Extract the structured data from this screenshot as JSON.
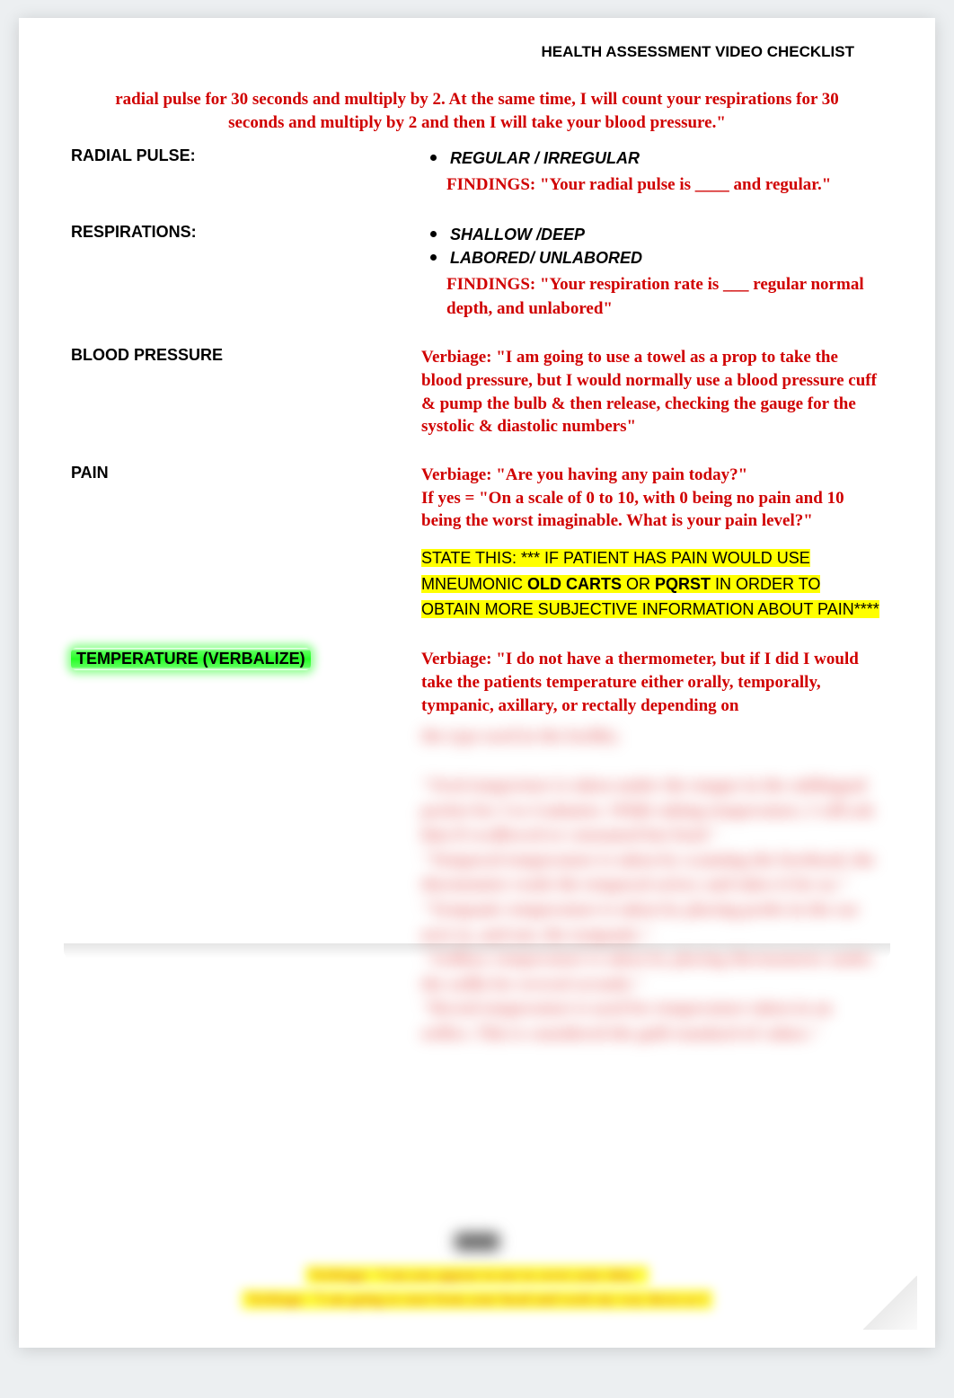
{
  "header": {
    "title": "HEALTH ASSESSMENT VIDEO CHECKLIST"
  },
  "intro": "radial pulse for 30 seconds and multiply by 2. At the same time, I will count your respirations for 30 seconds and multiply by 2 and then I will take your blood pressure.\"",
  "rows": {
    "radial": {
      "label": "RADIAL PULSE:",
      "bullets": [
        "REGULAR / IRREGULAR"
      ],
      "findings": "FINDINGS: \"Your radial pulse is ____ and regular.\""
    },
    "resp": {
      "label": "RESPIRATIONS:",
      "bullets": [
        "SHALLOW /DEEP",
        "LABORED/ UNLABORED"
      ],
      "findings": "FINDINGS: \"Your respiration rate is ___ regular normal depth, and unlabored\""
    },
    "bp": {
      "label": "BLOOD PRESSURE",
      "verbiage": "Verbiage: \"I am going to use a towel as a prop to take the blood pressure, but I would normally use a blood pressure cuff & pump the bulb & then release, checking the gauge for the systolic & diastolic numbers\""
    },
    "pain": {
      "label": "PAIN",
      "verbiage": "Verbiage: \"Are you having any pain today?\"\nIf yes = \"On a scale of 0 to 10, with 0 being no pain and 10 being the worst imaginable. What is your pain level?\"",
      "state_pre": "STATE THIS: *** IF PATIENT HAS PAIN WOULD USE MNEUMONIC ",
      "state_bold1": "OLD CARTS",
      "state_mid": " OR ",
      "state_bold2": "PQRST",
      "state_post": " IN ORDER TO OBTAIN MORE SUBJECTIVE INFORMATION ABOUT PAIN****"
    },
    "temp": {
      "label": "TEMPERATURE (VERBALIZE)",
      "verbiage": "Verbiage: \"I do not have a thermometer, but if I did I would take the patients temperature either orally, temporally, tympanic, axillary, or rectally depending on",
      "blurred": "the type used in the facility.\n\n\"Oral temperture is taken under the tongue in the sublingual pocket for 3 to 4 minutes. While taking temperature, I will ask him if swallowed or consumed hot food.\"\n\"Temporal temperature is taken by scanning the forehead, the thermomter reads the temporal artery and takes it for us.\"\n\"Tympanic temperature is taken by placing probe in the ear next to, and not, the tympanic.\"\n\"Axillary temperature is taken by placing thermometer under the axilla for several seconds.\"\n\"Rectal temperature is used for temperature taken in an orifice. This is considered the gold standard of values.\""
    }
  },
  "bottom": {
    "l1": "Verbiage: \"Can you appear to use to cover your skin.\"",
    "l2": "Verbiage: \"I am going to start from your head and work my way down as I"
  }
}
